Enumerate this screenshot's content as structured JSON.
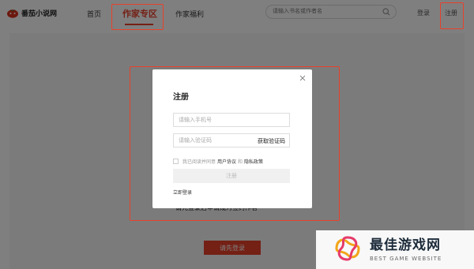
{
  "header": {
    "brand": "番茄小说网",
    "nav": [
      "首页",
      "作家专区",
      "作家福利"
    ],
    "search_placeholder": "请输入书名或作者名",
    "login": "登录",
    "register": "注册"
  },
  "page": {
    "behind_text": "请先登录后申请成为签约作者",
    "primary_button": "请先登录"
  },
  "modal": {
    "title": "注册",
    "phone_placeholder": "请输入手机号",
    "code_placeholder": "请输入验证码",
    "get_code": "获取验证码",
    "agree_prefix": "我已阅读并同意",
    "agreement_link": "用户协议",
    "agree_and": "和",
    "privacy_link": "隐私政策",
    "submit": "注册",
    "login_now": "立即登录"
  },
  "watermark": {
    "title": "最佳游戏网",
    "subtitle": "BEST GAME WEBSITE"
  },
  "colors": {
    "accent": "#e8412b",
    "annotation": "#e8412b"
  }
}
